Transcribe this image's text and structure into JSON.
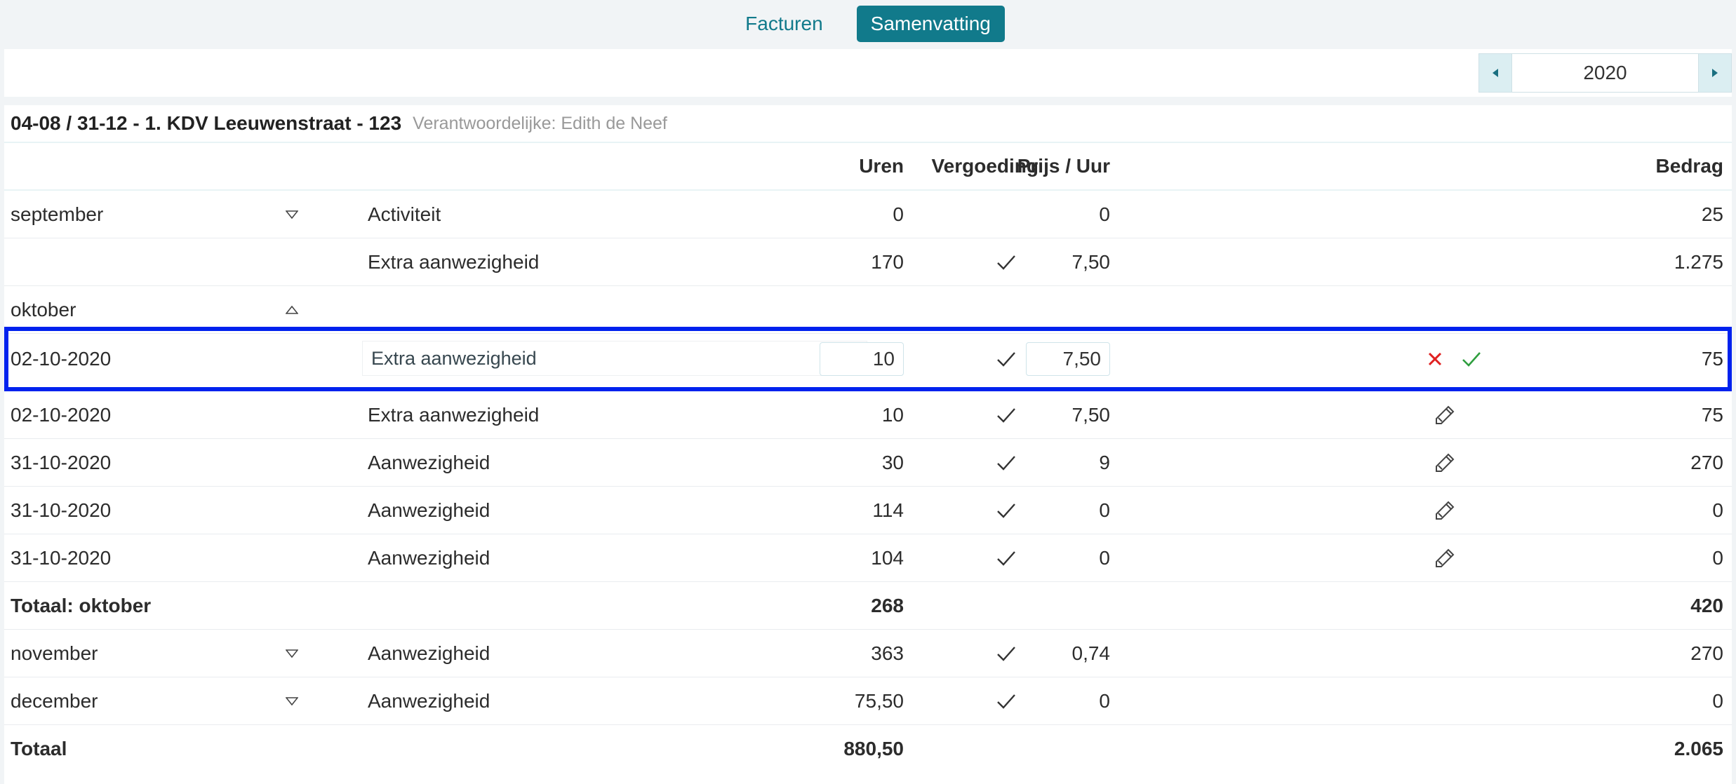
{
  "tabs": [
    {
      "label": "Facturen",
      "active": false
    },
    {
      "label": "Samenvatting",
      "active": true
    }
  ],
  "year_picker": {
    "value": "2020",
    "prev_icon": "caret-left-icon",
    "next_icon": "caret-right-icon"
  },
  "panel": {
    "title": "04-08 / 31-12 -  1. KDV Leeuwenstraat - 123",
    "responsible": "Verantwoordelijke: Edith de Neef"
  },
  "columns": {
    "vergoeding": "Vergoeding",
    "uren": "Uren",
    "prijs": "Prijs / Uur",
    "bedrag": "Bedrag"
  },
  "rows": {
    "sep1": {
      "month": "september",
      "type": "Activiteit",
      "uren": "0",
      "prijs": "0",
      "bedrag": "25"
    },
    "sep2": {
      "type": "Extra aanwezigheid",
      "uren": "170",
      "prijs": "7,50",
      "bedrag": "1.275"
    },
    "okt": {
      "month": "oktober"
    },
    "edit": {
      "date": "02-10-2020",
      "type": "Extra aanwezigheid",
      "uren": "10",
      "prijs": "7,50",
      "bedrag": "75"
    },
    "o1": {
      "date": "02-10-2020",
      "type": "Extra aanwezigheid",
      "uren": "10",
      "prijs": "7,50",
      "bedrag": "75"
    },
    "o2": {
      "date": "31-10-2020",
      "type": "Aanwezigheid",
      "uren": "30",
      "prijs": "9",
      "bedrag": "270"
    },
    "o3": {
      "date": "31-10-2020",
      "type": "Aanwezigheid",
      "uren": "114",
      "prijs": "0",
      "bedrag": "0"
    },
    "o4": {
      "date": "31-10-2020",
      "type": "Aanwezigheid",
      "uren": "104",
      "prijs": "0",
      "bedrag": "0"
    },
    "okt_total": {
      "label": "Totaal: oktober",
      "uren": "268",
      "bedrag": "420"
    },
    "nov": {
      "month": "november",
      "type": "Aanwezigheid",
      "uren": "363",
      "prijs": "0,74",
      "bedrag": "270"
    },
    "dec": {
      "month": "december",
      "type": "Aanwezigheid",
      "uren": "75,50",
      "prijs": "0",
      "bedrag": "0"
    },
    "total": {
      "label": "Totaal",
      "uren": "880,50",
      "bedrag": "2.065"
    }
  },
  "colors": {
    "accent": "#117a8b",
    "edit_border": "#0022ee",
    "cancel": "#e02020",
    "confirm": "#2e9e3e"
  }
}
